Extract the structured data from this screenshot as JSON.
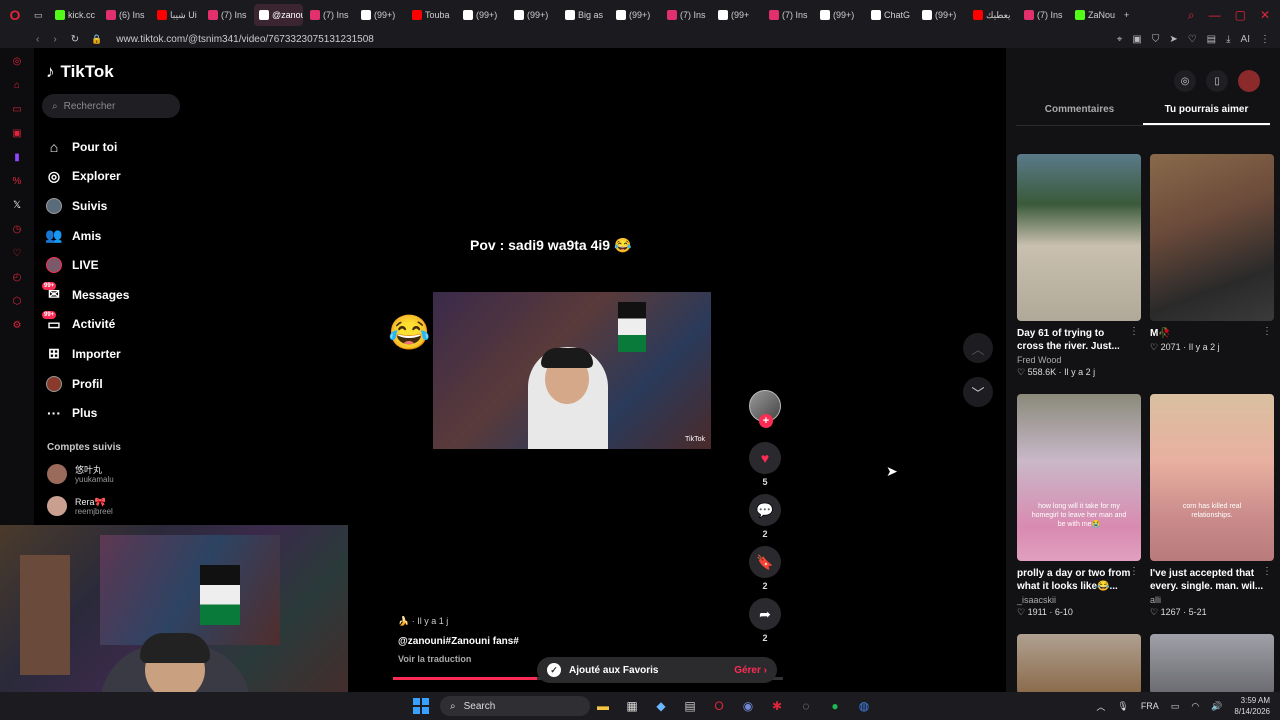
{
  "browser": {
    "tabs": [
      {
        "label": "kick.cc",
        "icon": "kick-icon",
        "color": "#53fc18"
      },
      {
        "label": "(6) Ins",
        "icon": "instagram-icon",
        "color": "#e1306c"
      },
      {
        "label": "شيبا Ui",
        "icon": "youtube-icon",
        "color": "#ff0000"
      },
      {
        "label": "(7) Ins",
        "icon": "instagram-icon",
        "color": "#e1306c"
      },
      {
        "label": "@zanou",
        "icon": "tiktok-icon",
        "color": "#ffffff",
        "active": true
      },
      {
        "label": "(7) Ins",
        "icon": "instagram-icon",
        "color": "#e1306c"
      },
      {
        "label": "(99+)",
        "icon": "tiktok-icon",
        "color": "#ffffff"
      },
      {
        "label": "Touba",
        "icon": "youtube-icon",
        "color": "#ff0000"
      },
      {
        "label": "(99+)",
        "icon": "tiktok-icon",
        "color": "#ffffff"
      },
      {
        "label": "(99+)",
        "icon": "tiktok-icon",
        "color": "#ffffff"
      },
      {
        "label": "Big as",
        "icon": "tiktok-icon",
        "color": "#ffffff"
      },
      {
        "label": "(99+)",
        "icon": "tiktok-icon",
        "color": "#ffffff"
      },
      {
        "label": "(7) Ins",
        "icon": "instagram-icon",
        "color": "#e1306c"
      },
      {
        "label": "(99+",
        "icon": "tiktok-icon",
        "color": "#ffffff"
      },
      {
        "label": "(7) Ins",
        "icon": "instagram-icon",
        "color": "#e1306c"
      },
      {
        "label": "(99+)",
        "icon": "tiktok-icon",
        "color": "#ffffff"
      },
      {
        "label": "ChatG",
        "icon": "chatgpt-icon",
        "color": "#ffffff"
      },
      {
        "label": "(99+)",
        "icon": "tiktok-icon",
        "color": "#ffffff"
      },
      {
        "label": "يعطيك",
        "icon": "youtube-icon",
        "color": "#ff0000"
      },
      {
        "label": "(7) Ins",
        "icon": "instagram-icon",
        "color": "#e1306c"
      },
      {
        "label": "ZaNou",
        "icon": "kick-icon",
        "color": "#53fc18"
      }
    ],
    "url": "www.tiktok.com/@tsnim341/video/7673323075131231508"
  },
  "tiktok": {
    "logo": "TikTok",
    "search_placeholder": "Rechercher",
    "menu": {
      "for_you": "Pour toi",
      "explore": "Explorer",
      "following": "Suivis",
      "friends": "Amis",
      "live": "LIVE",
      "messages": "Messages",
      "activity": "Activité",
      "upload": "Importer",
      "profile": "Profil",
      "more": "Plus"
    },
    "badge": "99+",
    "followed_title": "Comptes suivis",
    "followed": [
      {
        "name": "悠叶丸",
        "handle": "yuukamalu"
      },
      {
        "name": "Rera🎀",
        "handle": "reemjbreel"
      }
    ]
  },
  "video": {
    "title": "Pov : sadi9 wa9ta 4i9 😂",
    "emoji": "😂",
    "watermark": "TikTok",
    "likes": "5",
    "comments": "2",
    "saves": "2",
    "shares": "2",
    "time": "🍌 · Il y a 1 j",
    "caption": "@zanouni#Zanouni fans#",
    "translate": "Voir la traduction",
    "progress": 0.37
  },
  "toast": {
    "text": "Ajouté aux Favoris",
    "action": "Gérer"
  },
  "right_panel": {
    "tab_comments": "Commentaires",
    "tab_suggested": "Tu pourrais aimer",
    "cards": [
      {
        "title": "Day 61 of trying to cross the river. Just...",
        "author": "Fred Wood",
        "meta": "♡ 558.6K · Il y a 2 j",
        "overlay": ""
      },
      {
        "title": "M🥀",
        "author": "",
        "meta": "♡ 2071 · Il y a 2 j",
        "overlay": ""
      },
      {
        "title": "prolly a day or two from what it looks like😂...",
        "author": "_isaacskii",
        "meta": "♡ 1911 · 6-10",
        "overlay": "how long will it take for my homegirl to leave her man and be with me😭"
      },
      {
        "title": "I've just accepted that every. single. man. wil...",
        "author": "alli",
        "meta": "♡ 1267 · 5-21",
        "overlay": "corn has killed real relationships."
      }
    ]
  },
  "taskbar": {
    "search": "Search",
    "lang": "FRA",
    "time": "3:59 AM",
    "date": "8/14/2026"
  }
}
